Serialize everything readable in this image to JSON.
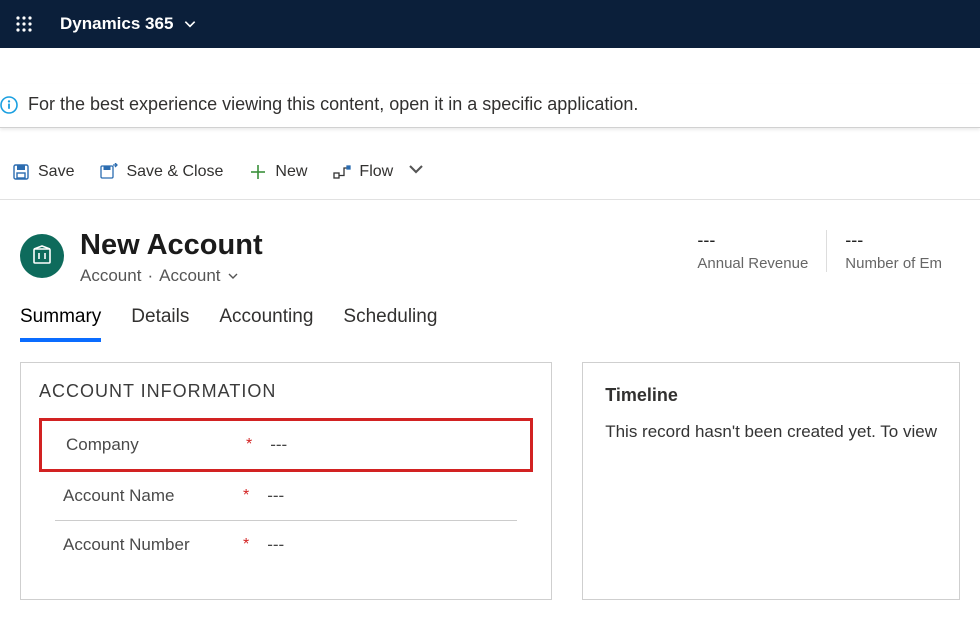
{
  "topbar": {
    "brand": "Dynamics 365"
  },
  "notice": {
    "text": "For the best experience viewing this content, open it in a specific application."
  },
  "commands": {
    "save": "Save",
    "save_close": "Save & Close",
    "new": "New",
    "flow": "Flow"
  },
  "record": {
    "title": "New Account",
    "breadcrumb_entity": "Account",
    "breadcrumb_view": "Account",
    "stats": [
      {
        "value": "---",
        "label": "Annual Revenue"
      },
      {
        "value": "---",
        "label": "Number of Em"
      }
    ]
  },
  "tabs": [
    "Summary",
    "Details",
    "Accounting",
    "Scheduling"
  ],
  "form": {
    "section_title": "ACCOUNT INFORMATION",
    "fields": [
      {
        "label": "Company",
        "required": "*",
        "value": "---"
      },
      {
        "label": "Account Name",
        "required": "*",
        "value": "---"
      },
      {
        "label": "Account Number",
        "required": "*",
        "value": "---"
      }
    ]
  },
  "timeline": {
    "title": "Timeline",
    "message": "This record hasn't been created yet.  To view"
  }
}
